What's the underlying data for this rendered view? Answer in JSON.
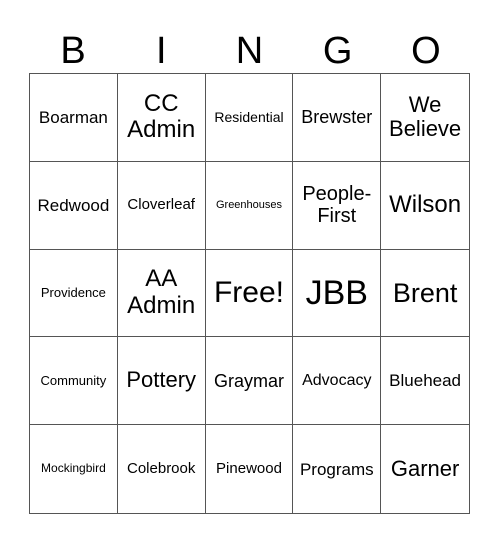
{
  "header": {
    "letters": [
      "B",
      "I",
      "N",
      "G",
      "O"
    ]
  },
  "grid": {
    "rows": [
      [
        "Boarman",
        "CC Admin",
        "Residential",
        "Brewster",
        "We Believe"
      ],
      [
        "Redwood",
        "Cloverleaf",
        "Greenhouses",
        "People-First",
        "Wilson"
      ],
      [
        "Providence",
        "AA Admin",
        "Free!",
        "JBB",
        "Brent"
      ],
      [
        "Community",
        "Pottery",
        "Graymar",
        "Advocacy",
        "Bluehead"
      ],
      [
        "Mockingbird",
        "Colebrook",
        "Pinewood",
        "Programs",
        "Garner"
      ]
    ]
  }
}
